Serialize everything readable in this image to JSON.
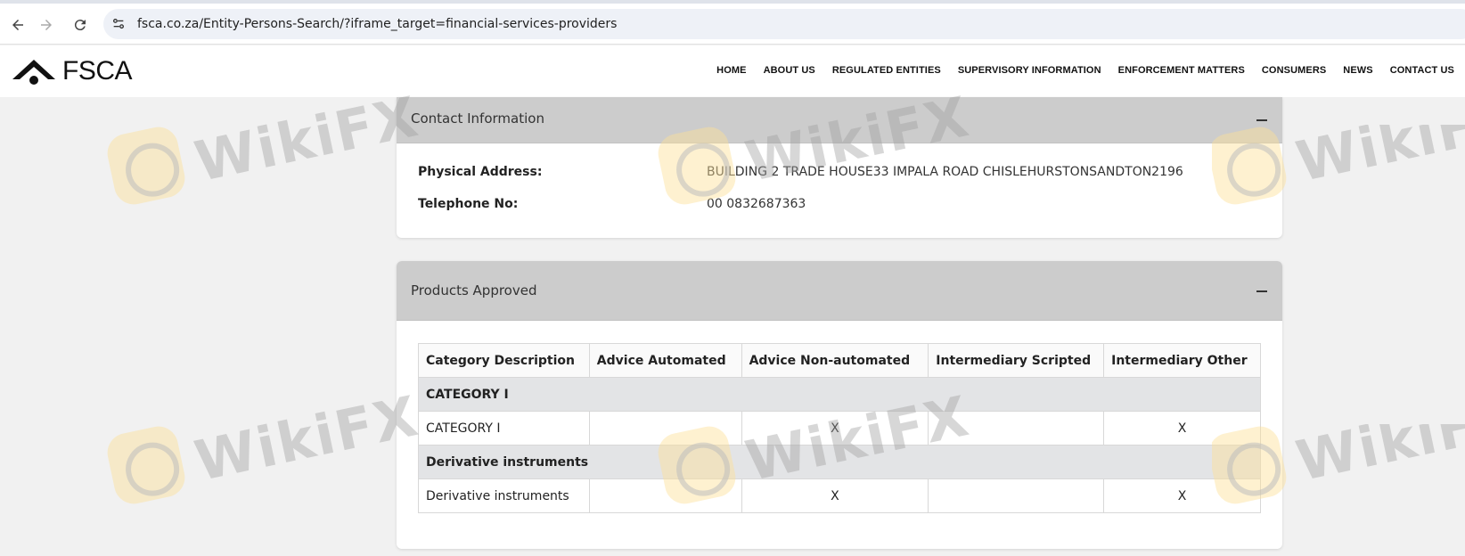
{
  "browser": {
    "url": "fsca.co.za/Entity-Persons-Search/?iframe_target=financial-services-providers"
  },
  "site": {
    "logo_text": "FSCA",
    "nav": [
      "HOME",
      "ABOUT US",
      "REGULATED ENTITIES",
      "SUPERVISORY INFORMATION",
      "ENFORCEMENT MATTERS",
      "CONSUMERS",
      "NEWS",
      "CONTACT US"
    ]
  },
  "contact": {
    "title": "Contact Information",
    "physical_label": "Physical Address:",
    "physical_value": "BUILDING 2 TRADE HOUSE33 IMPALA ROAD CHISLEHURSTONSANDTON2196",
    "phone_label": "Telephone No:",
    "phone_value": "00 0832687363"
  },
  "products": {
    "title": "Products Approved",
    "headers": [
      "Category Description",
      "Advice Automated",
      "Advice Non-automated",
      "Intermediary Scripted",
      "Intermediary Other"
    ],
    "groups": [
      {
        "name": "CATEGORY I",
        "row": [
          "CATEGORY I",
          "",
          "X",
          "",
          "X"
        ]
      },
      {
        "name": "Derivative instruments",
        "row": [
          "Derivative instruments",
          "",
          "X",
          "",
          "X"
        ]
      }
    ]
  },
  "watermark": {
    "text": "WikiFX"
  }
}
